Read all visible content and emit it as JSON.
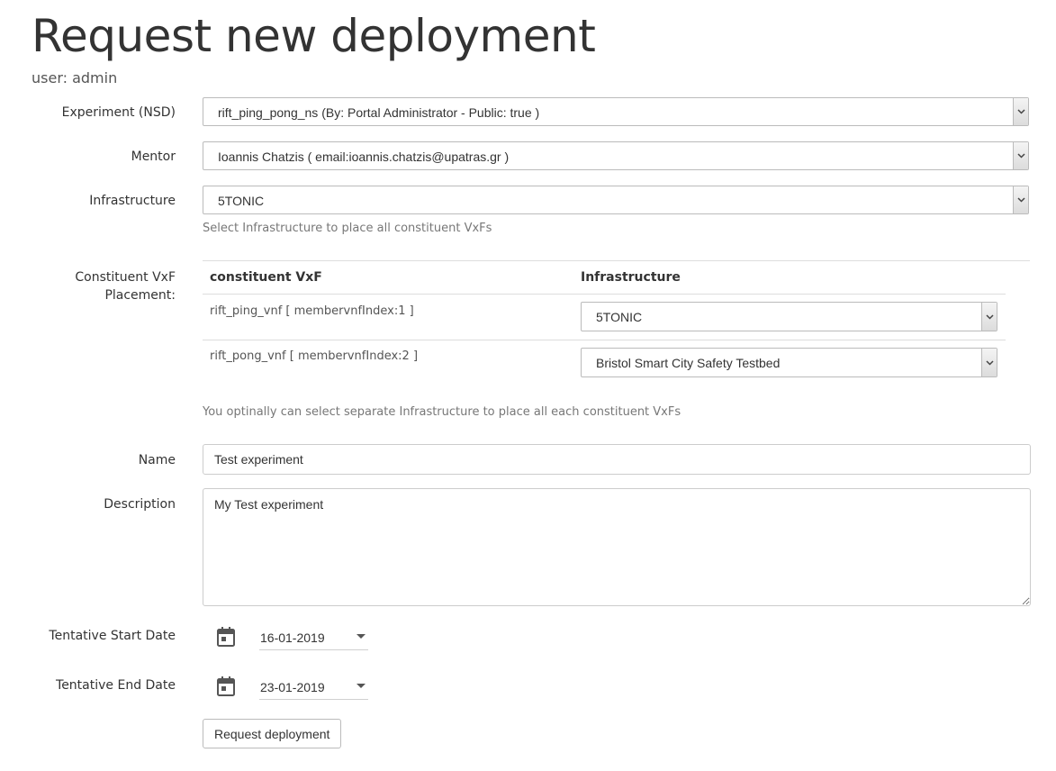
{
  "header": {
    "title": "Request new deployment",
    "user_line": "user: admin"
  },
  "form": {
    "experiment": {
      "label": "Experiment (NSD)",
      "value": "rift_ping_pong_ns (By: Portal Administrator - Public: true )"
    },
    "mentor": {
      "label": "Mentor",
      "value": "Ioannis Chatzis ( email:ioannis.chatzis@upatras.gr )"
    },
    "infrastructure": {
      "label": "Infrastructure",
      "value": "5TONIC",
      "help": "Select Infrastructure to place all constituent VxFs"
    },
    "placement": {
      "label_line1": "Constituent VxF",
      "label_line2": "Placement:",
      "columns": [
        "constituent VxF",
        "Infrastructure"
      ],
      "rows": [
        {
          "vxf": "rift_ping_vnf [ membervnfIndex:1 ]",
          "infrastructure": "5TONIC"
        },
        {
          "vxf": "rift_pong_vnf [ membervnfIndex:2 ]",
          "infrastructure": "Bristol Smart City Safety Testbed"
        }
      ],
      "help": "You optinally can select separate Infrastructure to place all each constituent VxFs"
    },
    "name": {
      "label": "Name",
      "value": "Test experiment"
    },
    "description": {
      "label": "Description",
      "value": "My Test experiment"
    },
    "start_date": {
      "label": "Tentative Start Date",
      "value": "16-01-2019"
    },
    "end_date": {
      "label": "Tentative End Date",
      "value": "23-01-2019"
    },
    "submit_label": "Request deployment"
  },
  "icons": {
    "select_arrow": "chevron-down-icon",
    "date_picker": "calendar-icon",
    "date_dropdown": "caret-down-icon"
  },
  "colors": {
    "text": "#333333",
    "help_text": "#777777",
    "border": "#bbbbbb"
  }
}
